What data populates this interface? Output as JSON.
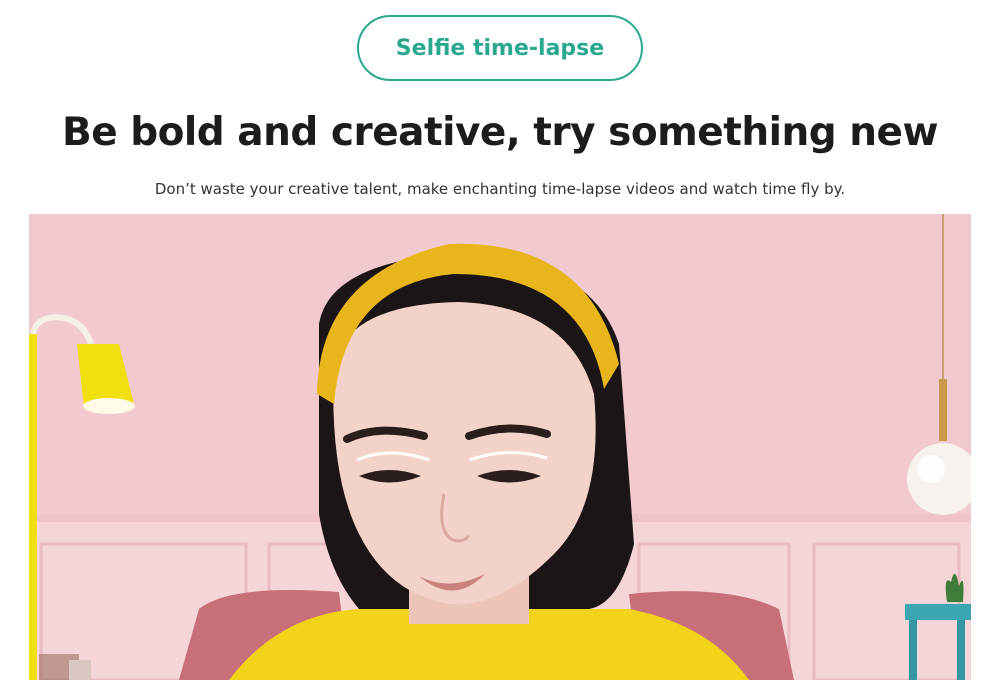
{
  "feature_badge": {
    "label": "Selfie time-lapse"
  },
  "hero": {
    "headline": "Be bold and creative, try something new",
    "subtitle": "Don’t waste your creative talent, make enchanting time-lapse videos and watch time fly by."
  },
  "photo": {
    "colors": {
      "wall": "#f2c9cf",
      "wainscot": "#f5d5d8",
      "lamp": "#f1df10",
      "headband": "#e8b51a",
      "sweater": "#f3d31a",
      "hair": "#1c1516",
      "skin": "#f3d2c9",
      "chair": "#c7707a",
      "table": "#3ca6b2",
      "globe": "#f7f2ee"
    }
  }
}
